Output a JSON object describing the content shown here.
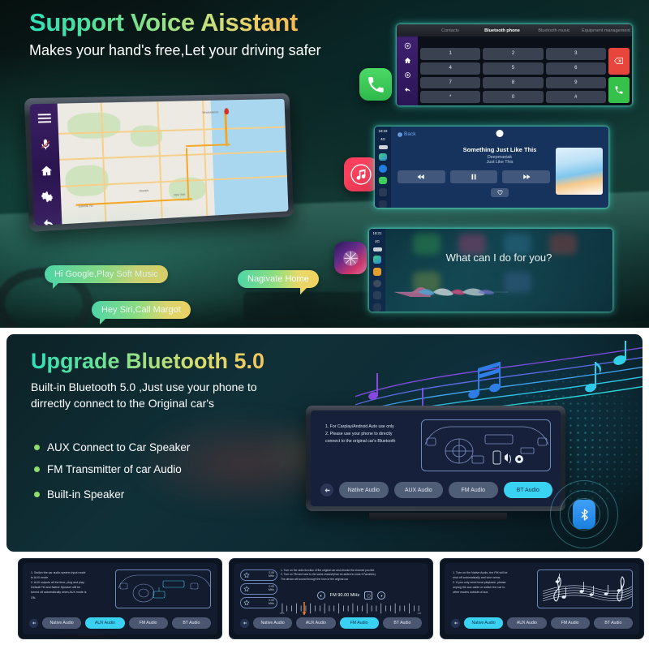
{
  "section1": {
    "title": "Support Voice Aisstant",
    "subtitle": "Makes your hand's free,Let your driving safer",
    "head_unit": {
      "sidebar_icons": [
        "menu-icon",
        "mic-muted-icon",
        "home-icon",
        "settings-icon",
        "back-icon"
      ],
      "map_labels": [
        "Summit, NJ",
        "New York",
        "Newark",
        "Meadowlands"
      ]
    },
    "app_icons": [
      {
        "name": "phone-app-icon",
        "label": "Phone"
      },
      {
        "name": "music-app-icon",
        "label": "Music"
      },
      {
        "name": "siri-app-icon",
        "label": "Siri"
      }
    ],
    "bluetooth_phone": {
      "tabs": [
        {
          "label": "Contacts",
          "active": false
        },
        {
          "label": "Bluetooth phone",
          "active": true
        },
        {
          "label": "Bluetooth music",
          "active": false
        },
        {
          "label": "Equipment management",
          "active": false
        }
      ],
      "keys": [
        "1",
        "2",
        "3",
        "4",
        "5",
        "6",
        "7",
        "8",
        "9",
        "*",
        "0",
        "#"
      ],
      "delete_label": "backspace-icon",
      "call_label": "call-icon"
    },
    "music_player": {
      "back_label": "Back",
      "track_title": "Something Just Like This",
      "artist": "Deepmaniak",
      "album": "Just Like This",
      "time": "18:23",
      "network": "4G",
      "controls": [
        "rewind-icon",
        "pause-icon",
        "forward-icon"
      ],
      "favorite_icon": "heart-icon"
    },
    "siri": {
      "prompt": "What can I do for you?",
      "time": "18:21",
      "network": "4G"
    },
    "bubbles": [
      "Hi Google,Play Soft Music",
      "Hey Siri,Call Margot",
      "Nagivate Home"
    ]
  },
  "section2": {
    "title": "Upgrade Bluetooth 5.0",
    "subtitle": "Built-in Bluetooth 5.0 ,Just use your phone to dirrectly connect to the Original car's",
    "features": [
      "AUX Connect to Car Speaker",
      "FM Transmitter of car Audio",
      "Built-in Speaker"
    ],
    "device": {
      "note_line1": "1. For Carplay/Android Auto use only",
      "note_line2": "2. Please use your phone to directly",
      "note_line3": "connect to the original car's Bluetooth",
      "modes": [
        {
          "label": "Native Audio",
          "active": false
        },
        {
          "label": "AUX Audio",
          "active": false
        },
        {
          "label": "FM Audio",
          "active": false
        },
        {
          "label": "BT Audio",
          "active": true
        }
      ],
      "back_icon": "arrow-left-icon"
    },
    "bluetooth_logo": "bluetooth-icon"
  },
  "thumbnails": [
    {
      "id": "aux",
      "note_line1": "1. Switch the car audio system input mode",
      "note_line2": "to AUX mode.",
      "note_line3": "2. AUX outputs all the time, plug and play.",
      "note_line4": "Default FM and Native Speaker will be",
      "note_line5": "turned off automatically when AUX mode is",
      "note_line6": "ON.",
      "modes": [
        {
          "label": "Native Audio",
          "active": false
        },
        {
          "label": "AUX Audio",
          "active": true
        },
        {
          "label": "FM Audio",
          "active": false
        },
        {
          "label": "BT Audio",
          "active": false
        }
      ]
    },
    {
      "id": "fm",
      "note_line1": "1. Turn on the radio function of the original car and choose the channel you like.",
      "note_line2": "2. Turn on FM and tune to the same channel(Can be added to most 3 Favorites).",
      "note_line3": "The device will sound through the horn of the original car.",
      "current_frequency": "FM 90.00 MHz",
      "dial_min": "87.5",
      "dial_max": "108",
      "presets": [
        {
          "value": "0.00",
          "unit": "MHz"
        },
        {
          "value": "0.00",
          "unit": "MHz"
        },
        {
          "value": "0.00",
          "unit": "MHz"
        }
      ],
      "modes": [
        {
          "label": "Native Audio",
          "active": false
        },
        {
          "label": "AUX Audio",
          "active": false
        },
        {
          "label": "FM Audio",
          "active": true
        },
        {
          "label": "BT Audio",
          "active": false
        }
      ]
    },
    {
      "id": "native",
      "note_line1": "1. Turn on the Native Audio, the FM will be",
      "note_line2": "shut off automatically and vice versa.",
      "note_line3": "2. If you only need local playback, please",
      "note_line4": "unplug the aux cable or switch the car to",
      "note_line5": "other modes outside of aux.",
      "modes": [
        {
          "label": "Native Audio",
          "active": true
        },
        {
          "label": "AUX Audio",
          "active": false
        },
        {
          "label": "FM Audio",
          "active": false
        },
        {
          "label": "BT Audio",
          "active": false
        }
      ]
    }
  ],
  "colors": {
    "accent_cyan": "#3ad2f2",
    "gradient_start": "#2de0b8",
    "gradient_end": "#f5c55f",
    "bullet_green": "#8ede6a",
    "bluetooth_blue": "#2b8ae8"
  }
}
